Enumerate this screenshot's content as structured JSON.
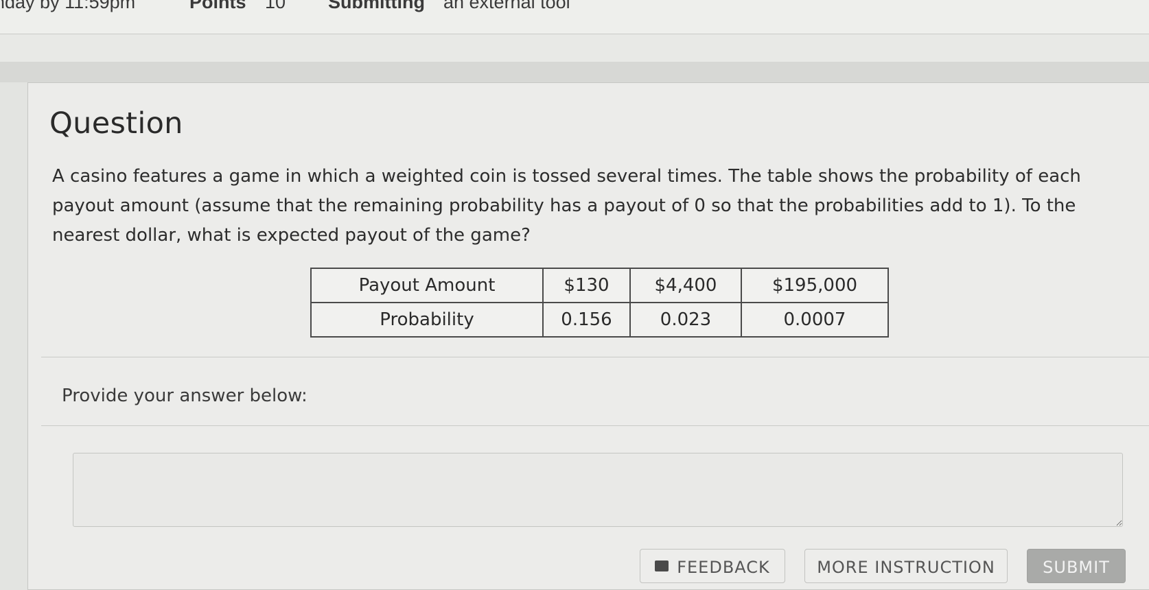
{
  "header": {
    "due_text": "nday by 11:59pm",
    "points_label": "Points",
    "points_value": "10",
    "submitting_label": "Submitting",
    "submitting_value": "an external tool"
  },
  "question": {
    "title": "Question",
    "text": "A casino features a game in which a weighted coin is tossed several times. The table shows the probability of each payout amount (assume that the remaining probability has a payout of 0 so that the probabilities add to 1). To the nearest dollar, what is expected payout of the game?",
    "table": {
      "row_labels": [
        "Payout Amount",
        "Probability"
      ],
      "payouts": [
        "$130",
        "$4,400",
        "$195,000"
      ],
      "probabilities": [
        "0.156",
        "0.023",
        "0.0007"
      ]
    }
  },
  "answer": {
    "prompt": "Provide your answer below:",
    "value": ""
  },
  "buttons": {
    "feedback": "FEEDBACK",
    "more_instruction": "MORE INSTRUCTION",
    "submit": "SUBMIT"
  }
}
